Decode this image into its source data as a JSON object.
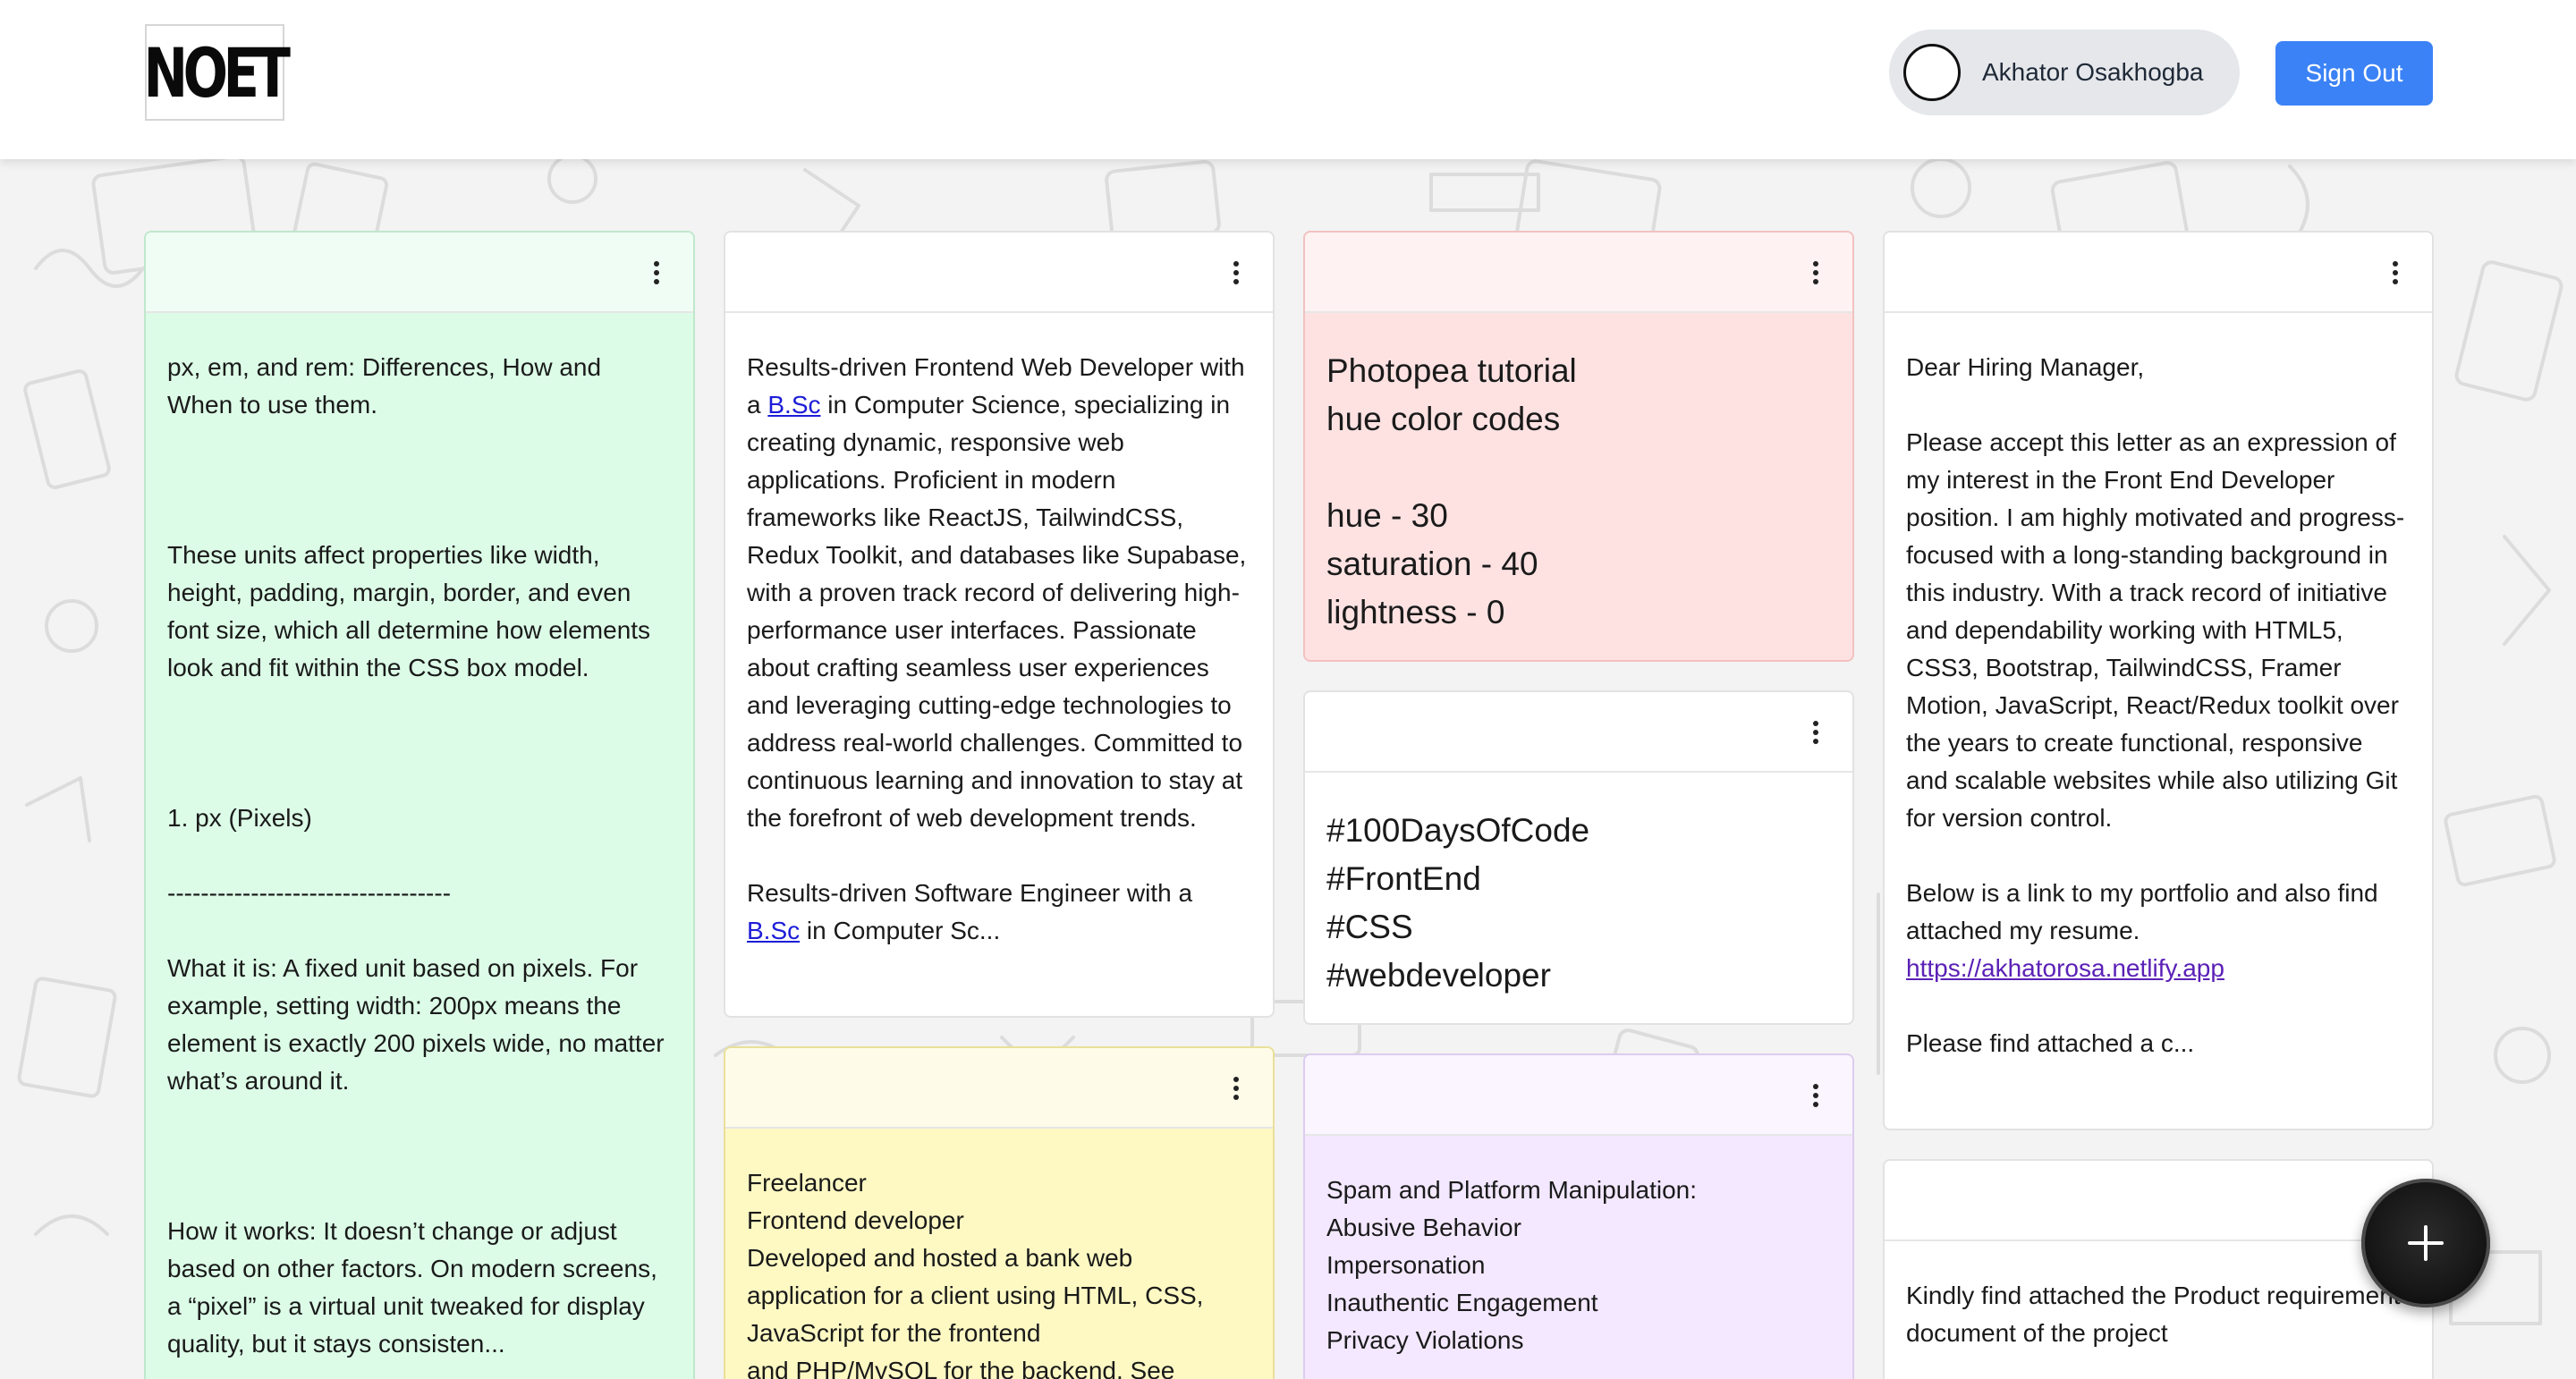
{
  "header": {
    "logo_text": "NOET",
    "user_name": "Akhator Osakhogba",
    "signout_label": "Sign Out"
  },
  "notes": {
    "n1": {
      "color": "#dcfce7",
      "text": "px, em, and rem: Differences, How and When to use them.\n\n\n\nThese units affect properties like width, height, padding, margin, border, and even font size, which all determine how elements look and fit within the CSS box model.\n\n\n\n1. px (Pixels)\n\n----------------------------------\n\nWhat it is: A fixed unit based on pixels. For example, setting width: 200px means the element is exactly 200 pixels wide, no matter what’s around it.\n\n\n\nHow it works: It doesn’t change or adjust based on other factors. On modern screens, a “pixel” is a virtual unit tweaked for display quality, but it stays consisten..."
    },
    "n2": {
      "color": "#ffffff",
      "p1": "Results-driven Frontend Web Developer with a ",
      "link1": "B.Sc",
      "p2": " in Computer Science, specializing in creating dynamic, responsive web applications. Proficient in modern frameworks like ReactJS, TailwindCSS, Redux Toolkit, and databases like Supabase, with a proven track record of delivering high-performance user interfaces. Passionate about crafting seamless user experiences and leveraging cutting-edge technologies to address real-world challenges. Committed to continuous learning and innovation to stay at the forefront of web development trends.\n\nResults-driven Software Engineer with a ",
      "link2": "B.Sc",
      "p3": " in Computer Sc..."
    },
    "n3": {
      "color": "#fef9c3",
      "text": "Freelancer\nFrontend developer\nDeveloped and hosted a bank web application for a client using HTML, CSS, JavaScript for the frontend\nand PHP/MySQL for the backend. See"
    },
    "n4": {
      "color": "#fee2e2",
      "text": "Photopea tutorial\nhue color codes\n\nhue - 30\nsaturation - 40\nlightness - 0"
    },
    "n5": {
      "color": "#ffffff",
      "text": "#100DaysOfCode\n#FrontEnd\n#CSS\n#webdeveloper"
    },
    "n6": {
      "color": "#f3e8ff",
      "text": "Spam and Platform Manipulation:\nAbusive Behavior\nImpersonation\nInauthentic Engagement\nPrivacy Violations"
    },
    "n7": {
      "color": "#ffffff",
      "p1": "Dear Hiring Manager,\n\nPlease accept this letter as an expression of my interest in the Front End Developer position. I am highly motivated and progress-focused with a long-standing background in this industry. With a track record of initiative and dependability working with HTML5, CSS3, Bootstrap, TailwindCSS, Framer Motion, JavaScript, React/Redux toolkit over the years to create functional, responsive and scalable websites while also utilizing Git for version control.\n\nBelow is a link to my portfolio and also find attached my resume.\n",
      "link": "https://akhatorosa.netlify.app",
      "p2": "\n\nPlease find attached a c..."
    },
    "n8": {
      "color": "#ffffff",
      "text": "Kindly find attached the Product requirement document of the project"
    }
  },
  "icons": {
    "menu": "kebab-menu-icon",
    "add": "plus-icon"
  }
}
